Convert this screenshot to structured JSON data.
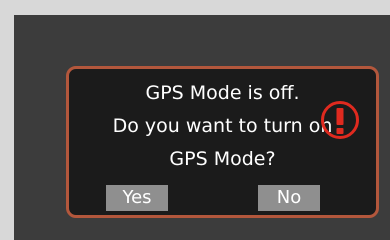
{
  "dialog": {
    "line1": "GPS Mode is off.",
    "line2": "Do you want to turn on",
    "line3": "GPS Mode?",
    "yes_label": "Yes",
    "no_label": "No",
    "icon": "exclamation-alert-icon"
  },
  "colors": {
    "screen_background": "#3c3c3c",
    "dialog_background": "#1b1b1b",
    "dialog_border": "#b3573c",
    "alert_red": "#e02a1f",
    "button_background": "#8f8f8f",
    "text": "#ffffff"
  }
}
